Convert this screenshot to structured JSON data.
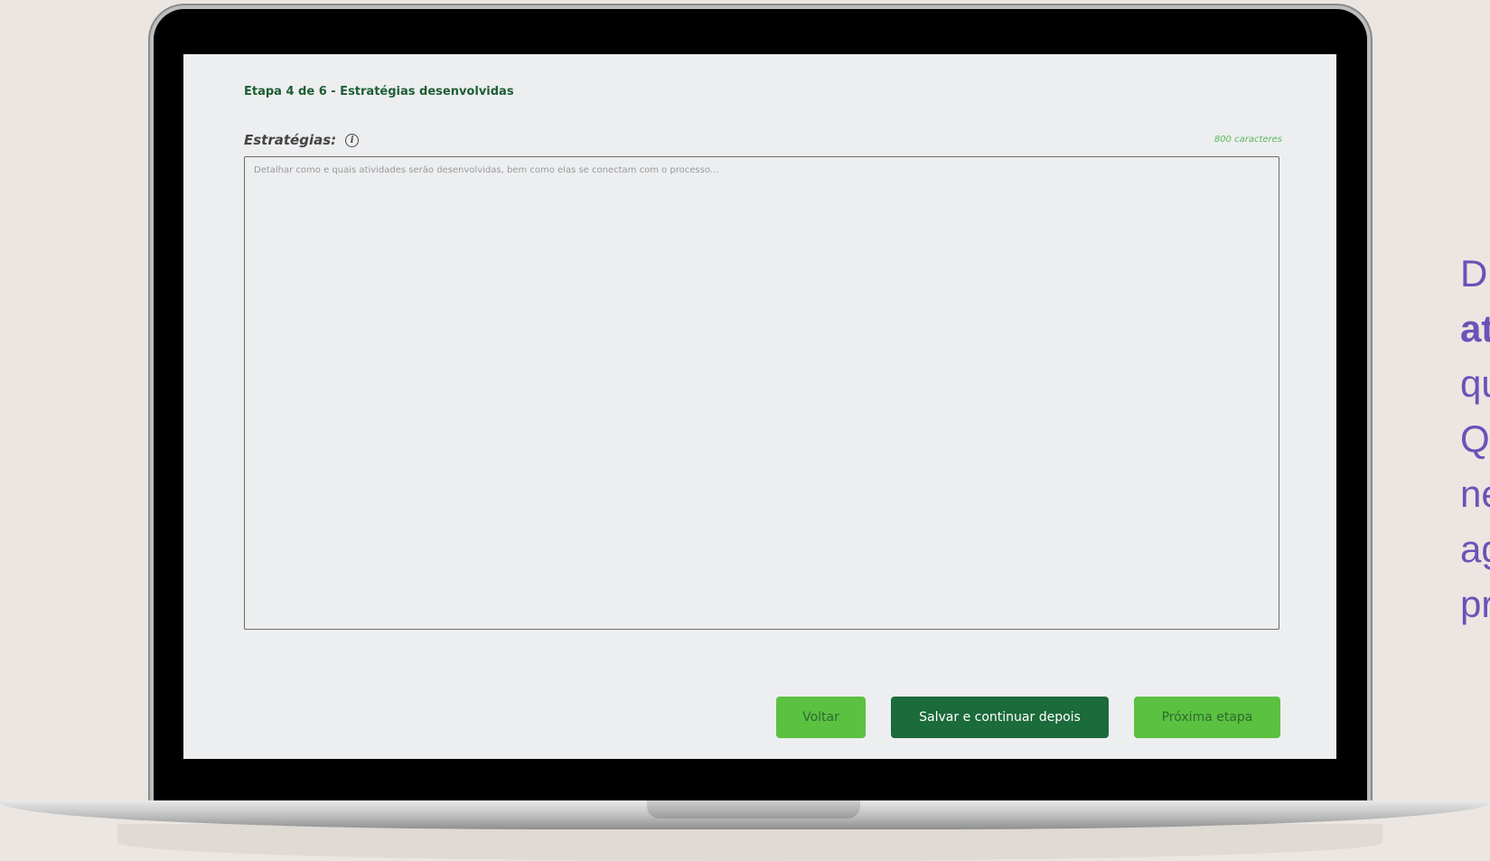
{
  "step": {
    "title": "Etapa 4 de 6 - Estratégias desenvolvidas"
  },
  "field": {
    "label": "Estratégias:",
    "info_icon": "info-icon",
    "char_limit": "800 caracteres",
    "placeholder": "Detalhar como e quais atividades serão desenvolvidas, bem como elas se conectam com o processo..."
  },
  "buttons": {
    "back": "Voltar",
    "save": "Salvar e continuar depois",
    "next": "Próxima etapa"
  },
  "side_text": [
    "D",
    "at",
    "qu",
    "Q",
    "ne",
    "ag",
    "pr"
  ],
  "colors": {
    "step_title": "#1e5e34",
    "primary_dark": "#1c6b3b",
    "primary_light": "#5bc141",
    "side_text": "#6a52b8",
    "background": "#ebe6e1"
  }
}
